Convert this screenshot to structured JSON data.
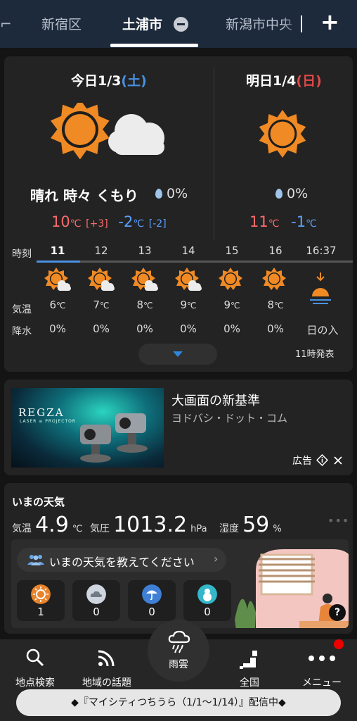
{
  "tabs": {
    "items": [
      "新宿区",
      "土浦市",
      "新潟市中央"
    ],
    "active_index": 1
  },
  "today": {
    "label": "今日1/3",
    "weekday": "(土)",
    "weather": "晴れ 時々 くもり",
    "precip": "0%",
    "high": "10",
    "high_unit": "℃",
    "high_diff": "[+3]",
    "low": "-2",
    "low_unit": "℃",
    "low_diff": "[-2]",
    "icons": [
      "sun-icon",
      "cloud-icon"
    ]
  },
  "tomorrow": {
    "label": "明日1/4",
    "weekday": "(日)",
    "precip": "0%",
    "high": "11",
    "high_unit": "℃",
    "low": "-1",
    "low_unit": "℃",
    "icons": [
      "sun-icon"
    ]
  },
  "hourly": {
    "row_labels": {
      "time": "時刻",
      "temp": "気温",
      "precip": "降水"
    },
    "hours": [
      {
        "time": "11",
        "temp": "6",
        "unit": "℃",
        "precip": "0%",
        "icon": "sun-cloud-icon"
      },
      {
        "time": "12",
        "temp": "7",
        "unit": "℃",
        "precip": "0%",
        "icon": "sun-cloud-icon"
      },
      {
        "time": "13",
        "temp": "8",
        "unit": "℃",
        "precip": "0%",
        "icon": "sun-cloud-icon"
      },
      {
        "time": "14",
        "temp": "9",
        "unit": "℃",
        "precip": "0%",
        "icon": "sun-cloud-icon"
      },
      {
        "time": "15",
        "temp": "9",
        "unit": "℃",
        "precip": "0%",
        "icon": "sun-icon"
      },
      {
        "time": "16",
        "temp": "8",
        "unit": "℃",
        "precip": "0%",
        "icon": "sun-icon"
      }
    ],
    "sunset": {
      "time": "16:37",
      "label": "日の入",
      "icon": "sunset-icon"
    },
    "issued": "11時発表"
  },
  "ad": {
    "brand": "REGZA",
    "brand_sub": "LASER ≡ PROJECTOR",
    "title": "大画面の新基準",
    "advertiser": "ヨドバシ・ドット・コム",
    "label": "広告"
  },
  "current": {
    "title": "いまの天気",
    "temp_label": "気温",
    "temp": "4.9",
    "temp_unit": "℃",
    "pressure_label": "気圧",
    "pressure": "1013.2",
    "pressure_unit": "hPa",
    "humidity_label": "湿度",
    "humidity": "59",
    "humidity_unit": "%",
    "ask": "いまの天気を教えてください",
    "votes": [
      {
        "icon": "sunny-vote-icon",
        "count": "1",
        "color": "#e8832a"
      },
      {
        "icon": "cloudy-vote-icon",
        "count": "0",
        "color": "#cfd6df"
      },
      {
        "icon": "rain-vote-icon",
        "count": "0",
        "color": "#3f7fd6"
      },
      {
        "icon": "snow-vote-icon",
        "count": "0",
        "color": "#34b7c9"
      }
    ]
  },
  "nav": {
    "items": [
      {
        "label": "地点検索",
        "icon": "search-icon"
      },
      {
        "label": "地域の話題",
        "icon": "rss-icon"
      },
      {
        "label": "雨雲",
        "icon": "rain-cloud-icon"
      },
      {
        "label": "全国",
        "icon": "japan-map-icon"
      },
      {
        "label": "メニュー",
        "icon": "more-icon"
      }
    ],
    "banner": "◆『マイシティつちうら（1/1〜1/14）』配信中◆"
  },
  "colors": {
    "high": "#ff6b6b",
    "low": "#5aa0ff",
    "sun": "#f08a24",
    "accent": "#4a90e2"
  }
}
